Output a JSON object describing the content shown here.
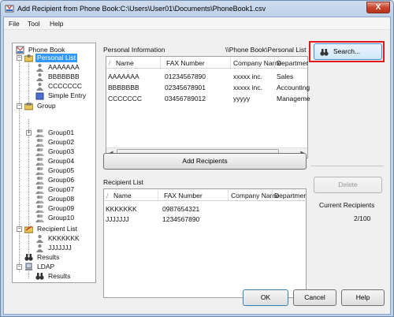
{
  "window": {
    "title": "Add Recipient from Phone Book:C:\\Users\\User01\\Documents\\PhoneBook1.csv",
    "close_label": "X"
  },
  "menu": [
    "File",
    "Tool",
    "Help"
  ],
  "tree": {
    "root": "Phone Book",
    "personal_list": "Personal List",
    "personal_entries": [
      "AAAAAAA",
      "BBBBBBB",
      "CCCCCCC"
    ],
    "simple_entry": "Simple Entry",
    "group": "Group",
    "groups": [
      "Group01",
      "Group02",
      "Group03",
      "Group04",
      "Group05",
      "Group06",
      "Group07",
      "Group08",
      "Group09",
      "Group10"
    ],
    "recipient_list": "Recipient List",
    "recipient_entries": [
      "KKKKKKK",
      "JJJJJJJ"
    ],
    "results": "Results",
    "ldap": "LDAP",
    "ldap_results": "Results"
  },
  "personal_info": {
    "label": "Personal Information",
    "path": "\\\\Phone Book\\Personal List",
    "columns": [
      "Name",
      "FAX Number",
      "Company Name",
      "Departmer"
    ],
    "rows": [
      [
        "AAAAAAA",
        "01234567890",
        "xxxxx inc.",
        "Sales"
      ],
      [
        "BBBBBBB",
        "02345678901",
        "xxxxx inc.",
        "Accounting"
      ],
      [
        "CCCCCCC",
        "03456789012",
        "yyyyy",
        "Manageme"
      ]
    ]
  },
  "recipient_list": {
    "label": "Recipient List",
    "columns": [
      "Name",
      "FAX Number",
      "Company Name",
      "Departmer"
    ],
    "rows": [
      [
        "KKKKKKK",
        "0987654321",
        "",
        ""
      ],
      [
        "JJJJJJJ",
        "1234567890",
        "",
        ""
      ]
    ]
  },
  "buttons": {
    "search": "Search...",
    "add_recipients": "Add Recipients",
    "delete": "Delete",
    "ok": "OK",
    "cancel": "Cancel",
    "help": "Help"
  },
  "current_recipients": {
    "label": "Current Recipients",
    "value": "2/100"
  },
  "colors": {
    "highlight": "#e01a1a",
    "selection": "#3399ff"
  }
}
